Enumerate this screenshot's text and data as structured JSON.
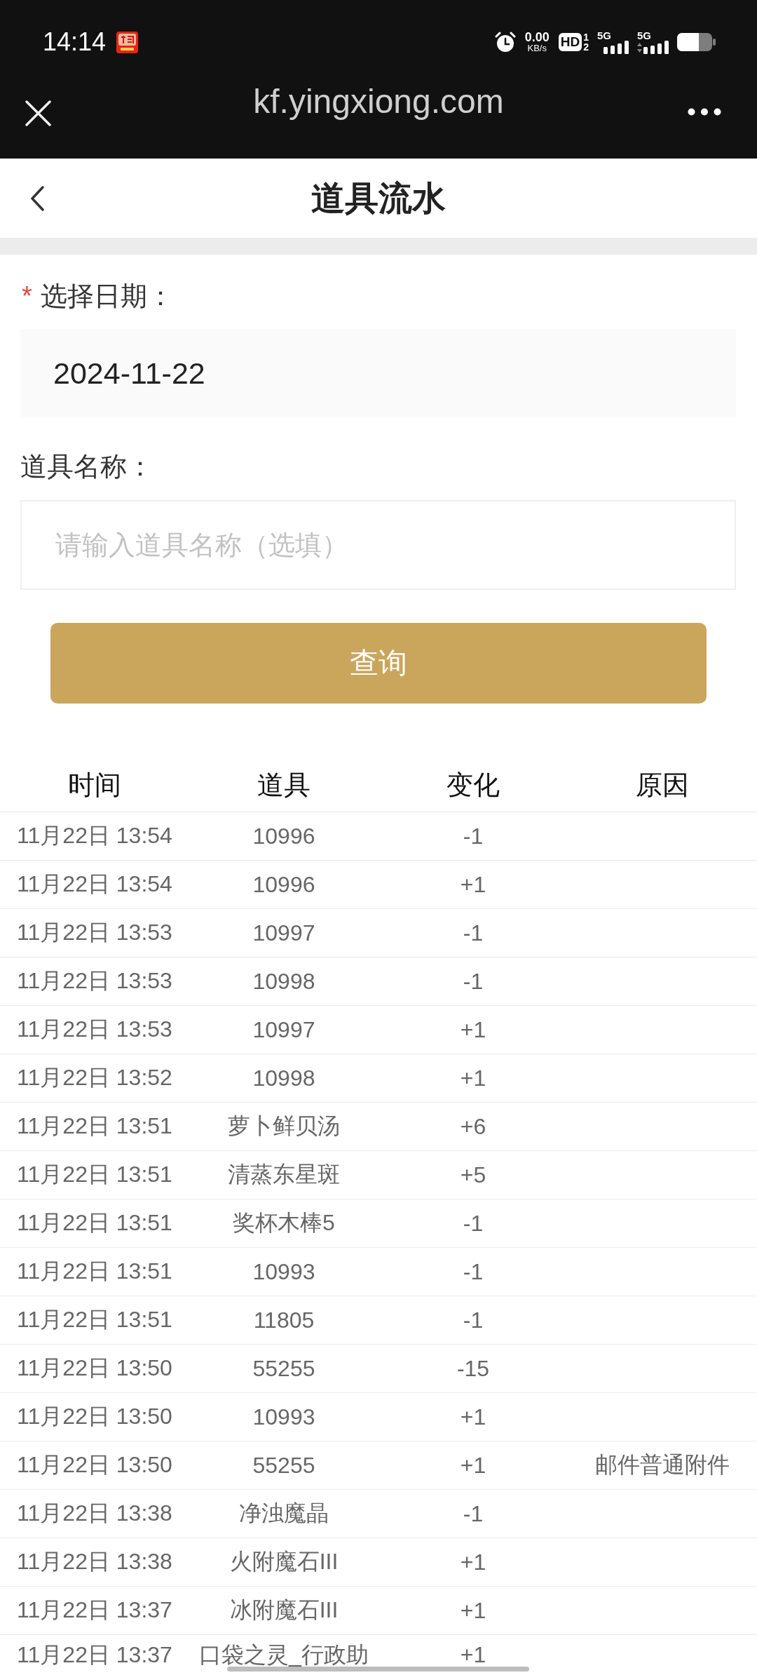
{
  "status_bar": {
    "time": "14:14",
    "net_speed": {
      "value": "0.00",
      "unit": "KB/s"
    },
    "hd_voice": {
      "label": "HD",
      "sims": [
        "1",
        "2"
      ]
    },
    "networks": [
      {
        "type": "5G",
        "data_activity": false
      },
      {
        "type": "5G",
        "data_activity": true
      }
    ]
  },
  "browser_bar": {
    "url": "kf.yingxiong.com"
  },
  "header": {
    "title": "道具流水"
  },
  "form": {
    "fields": [
      {
        "kind": "date",
        "label": "选择日期：",
        "required_mark": "*",
        "value": "2024-11-22"
      },
      {
        "kind": "text",
        "label": "道具名称：",
        "placeholder": "请输入道具名称（选填）"
      }
    ],
    "submit": "查询"
  },
  "table": {
    "columns": [
      "时间",
      "道具",
      "变化",
      "原因"
    ],
    "rows": [
      {
        "time": "11月22日 13:54",
        "item": "10996",
        "change": "-1"
      },
      {
        "time": "11月22日 13:54",
        "item": "10996",
        "change": "+1"
      },
      {
        "time": "11月22日 13:53",
        "item": "10997",
        "change": "-1"
      },
      {
        "time": "11月22日 13:53",
        "item": "10998",
        "change": "-1"
      },
      {
        "time": "11月22日 13:53",
        "item": "10997",
        "change": "+1"
      },
      {
        "time": "11月22日 13:52",
        "item": "10998",
        "change": "+1"
      },
      {
        "time": "11月22日 13:51",
        "item": "萝卜鲜贝汤",
        "change": "+6"
      },
      {
        "time": "11月22日 13:51",
        "item": "清蒸东星斑",
        "change": "+5"
      },
      {
        "time": "11月22日 13:51",
        "item": "奖杯木棒5",
        "change": "-1"
      },
      {
        "time": "11月22日 13:51",
        "item": "10993",
        "change": "-1"
      },
      {
        "time": "11月22日 13:51",
        "item": "11805",
        "change": "-1"
      },
      {
        "time": "11月22日 13:50",
        "item": "55255",
        "change": "-15"
      },
      {
        "time": "11月22日 13:50",
        "item": "10993",
        "change": "+1"
      },
      {
        "time": "11月22日 13:50",
        "item": "55255",
        "change": "+1",
        "reason": "邮件普通附件"
      },
      {
        "time": "11月22日 13:38",
        "item": "净浊魔晶",
        "change": "-1"
      },
      {
        "time": "11月22日 13:38",
        "item": "火附魔石III",
        "change": "+1"
      },
      {
        "time": "11月22日 13:37",
        "item": "冰附魔石III",
        "change": "+1"
      },
      {
        "time": "11月22日 13:37",
        "item": "口袋之灵_行政助",
        "change": "+1"
      }
    ]
  }
}
